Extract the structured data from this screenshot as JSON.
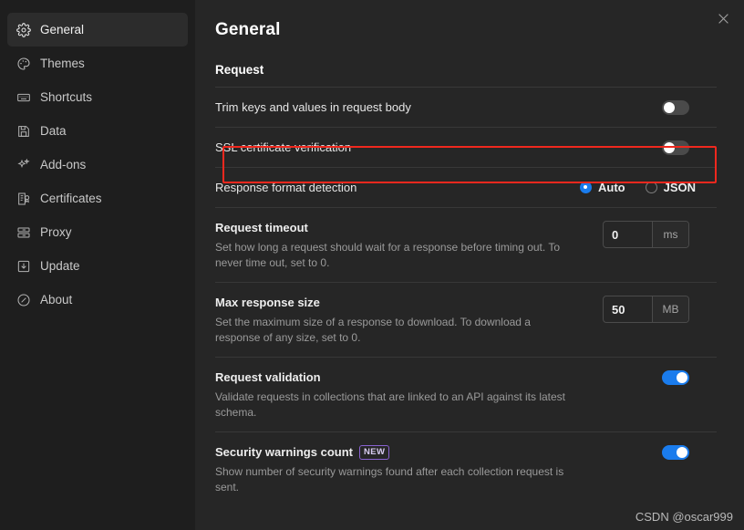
{
  "sidebar": {
    "items": [
      {
        "label": "General",
        "icon": "gear-icon",
        "active": true
      },
      {
        "label": "Themes",
        "icon": "palette-icon",
        "active": false
      },
      {
        "label": "Shortcuts",
        "icon": "keyboard-icon",
        "active": false
      },
      {
        "label": "Data",
        "icon": "save-disk-icon",
        "active": false
      },
      {
        "label": "Add-ons",
        "icon": "sparkles-icon",
        "active": false
      },
      {
        "label": "Certificates",
        "icon": "certificate-icon",
        "active": false
      },
      {
        "label": "Proxy",
        "icon": "server-icon",
        "active": false
      },
      {
        "label": "Update",
        "icon": "download-icon",
        "active": false
      },
      {
        "label": "About",
        "icon": "info-icon",
        "active": false
      }
    ]
  },
  "main": {
    "title": "General",
    "section": "Request",
    "close_icon": "close-icon",
    "rows": [
      {
        "label": "Trim keys and values in request body",
        "desc": "",
        "control": "toggle",
        "value": "off"
      },
      {
        "label": "SSL certificate verification",
        "desc": "",
        "control": "toggle",
        "value": "off",
        "highlighted": true
      },
      {
        "label": "Response format detection",
        "desc": "",
        "control": "radio",
        "options": [
          "Auto",
          "JSON"
        ],
        "selected": "Auto"
      },
      {
        "label": "Request timeout",
        "desc": "Set how long a request should wait for a response before timing out. To never time out, set to 0.",
        "control": "number",
        "value": "0",
        "unit": "ms"
      },
      {
        "label": "Max response size",
        "desc": "Set the maximum size of a response to download. To download a response of any size, set to 0.",
        "control": "number",
        "value": "50",
        "unit": "MB"
      },
      {
        "label": "Request validation",
        "desc": "Validate requests in collections that are linked to an API against its latest schema.",
        "control": "toggle",
        "value": "on"
      },
      {
        "label": "Security warnings count",
        "badge": "NEW",
        "desc": "Show number of security warnings found after each collection request is sent.",
        "control": "toggle",
        "value": "on"
      }
    ]
  },
  "watermark": "CSDN @oscar999",
  "colors": {
    "accent_blue": "#1a7ced",
    "badge_purple": "#8a63d2",
    "highlight_red": "#f0281e",
    "sidebar_bg": "#1e1e1e",
    "main_bg": "#262626"
  }
}
